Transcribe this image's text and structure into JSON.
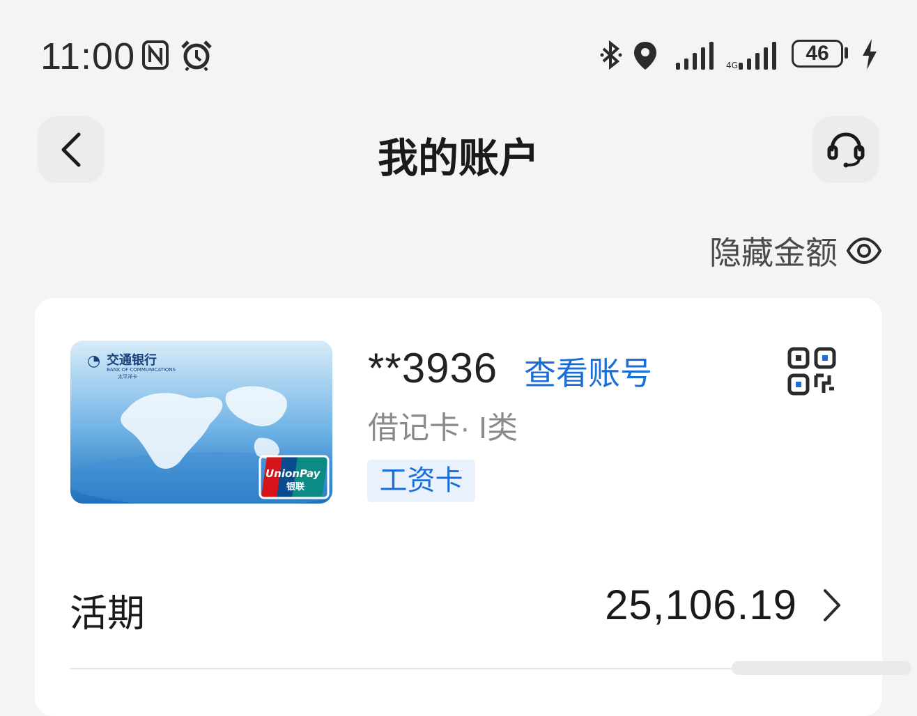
{
  "status_bar": {
    "time": "11:00",
    "icons": [
      "nfc-icon",
      "alarm-icon",
      "bluetooth-icon",
      "location-icon",
      "signal-icon",
      "signal-icon"
    ],
    "battery_level": "46"
  },
  "header": {
    "title": "我的账户",
    "back_icon": "chevron-left-icon",
    "support_icon": "headset-icon"
  },
  "hide_amount": {
    "label": "隐藏金额",
    "icon": "eye-icon"
  },
  "account": {
    "masked_number": "**3936",
    "view_number_link": "查看账号",
    "card_type": "借记卡· I类",
    "tag": "工资卡",
    "qr_icon": "qr-code-icon",
    "card_image": {
      "bank_name": "交通银行",
      "bank_name_en": "BANK OF COMMUNICATIONS",
      "card_series": "太平洋卡",
      "network": "UnionPay",
      "network_cn": "银联"
    },
    "balance_label": "活期",
    "balance_value": "25,106.19"
  },
  "colors": {
    "accent": "#1a6ed8",
    "background": "#f4f4f4",
    "card": "#ffffff"
  }
}
